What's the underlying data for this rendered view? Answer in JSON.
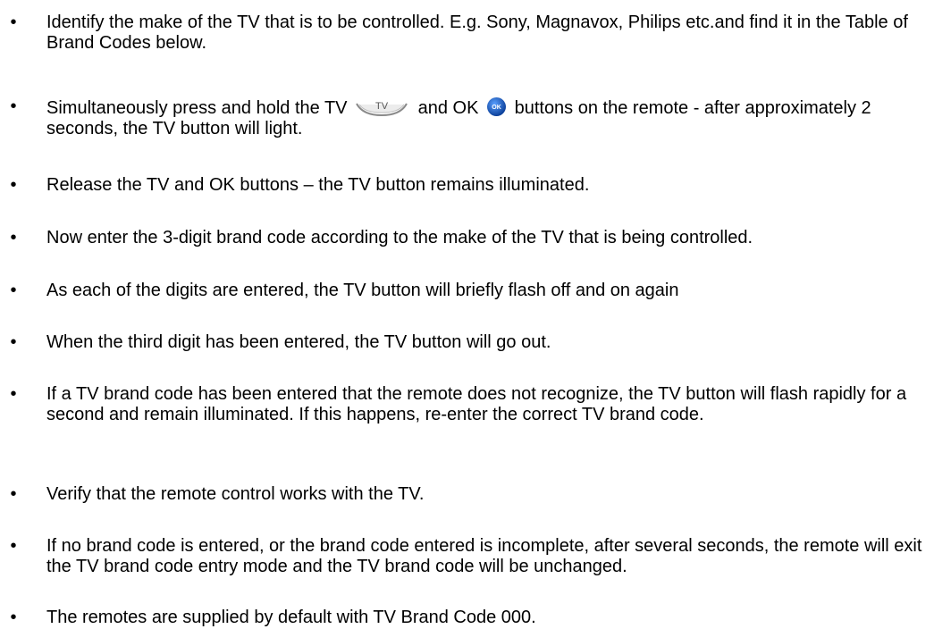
{
  "bullet_glyph": "•",
  "items": [
    {
      "text": "Identify the make of the TV that is to be controlled. E.g. Sony, Magnavox, Philips etc.and find it in the Table of Brand Codes below."
    },
    {
      "part1": "Simultaneously press and hold the TV",
      "tv_label": "TV",
      "part2": "and OK",
      "ok_label": "OK",
      "part3": "buttons on the remote - after approximately 2 seconds, the TV button will light."
    },
    {
      "text": "Release the TV and OK buttons – the TV button remains illuminated."
    },
    {
      "text": "Now enter the 3-digit brand code according to the make of the TV that is being controlled."
    },
    {
      "text": "As each of the digits are entered, the TV button will briefly flash off and on again"
    },
    {
      "text": "When the third digit has been entered, the TV button will go out."
    },
    {
      "text": "If a TV brand code has been entered that the remote does not recognize, the TV button will flash rapidly for a second and remain illuminated.  If this happens, re-enter the correct TV brand code."
    },
    {
      "text": "Verify that the remote control works with the TV."
    },
    {
      "text": "If no brand code is entered, or the brand code entered is incomplete, after several seconds, the remote will exit the TV brand code entry mode and the TV brand code will be unchanged."
    },
    {
      "text": "The remotes are supplied by default with TV Brand Code 000."
    }
  ],
  "icons": {
    "tv_button": "tv-button-icon",
    "ok_button": "ok-button-icon",
    "ok_color": "#1060c8",
    "tv_color": "#9a9a9a"
  }
}
